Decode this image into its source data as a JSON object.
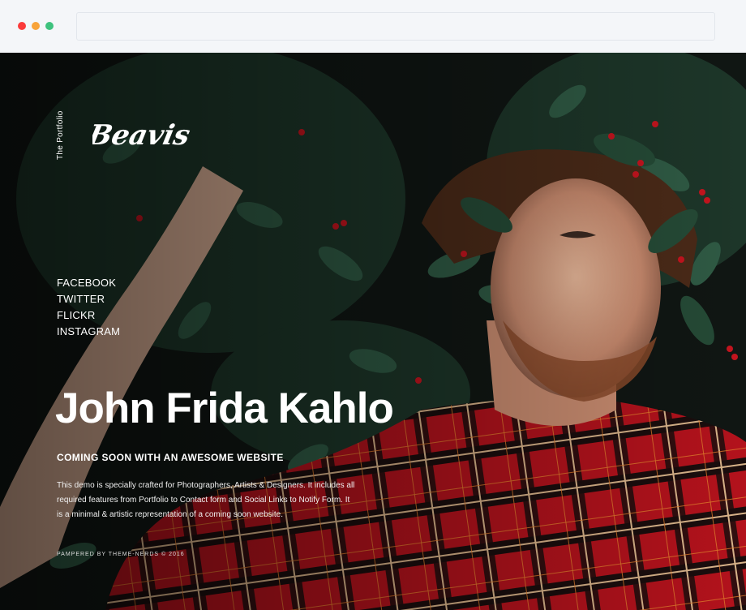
{
  "brand": {
    "tagline": "The Portfolio",
    "logo_text": "Beavis"
  },
  "social_links": [
    "FACEBOOK",
    "TWITTER",
    "FLICKR",
    "INSTAGRAM"
  ],
  "hero": {
    "headline": "John Frida Kahlo",
    "subheading": "COMING SOON WITH AN AWESOME WEBSITE",
    "description": "This demo is specially crafted for Photographers, Artists & Designers. It includes all required features from Portfolio to Contact form and Social Links to Notify Form. It is a minimal & artistic representation of a coming soon website."
  },
  "footer": {
    "credit": "PAMPERED BY THEME-NERDS © 2016"
  },
  "colors": {
    "window_red": "#fb3b3b",
    "window_yellow": "#f8a33a",
    "window_green": "#3ec27e",
    "text": "#ffffff",
    "background": "#0d0f0e"
  }
}
